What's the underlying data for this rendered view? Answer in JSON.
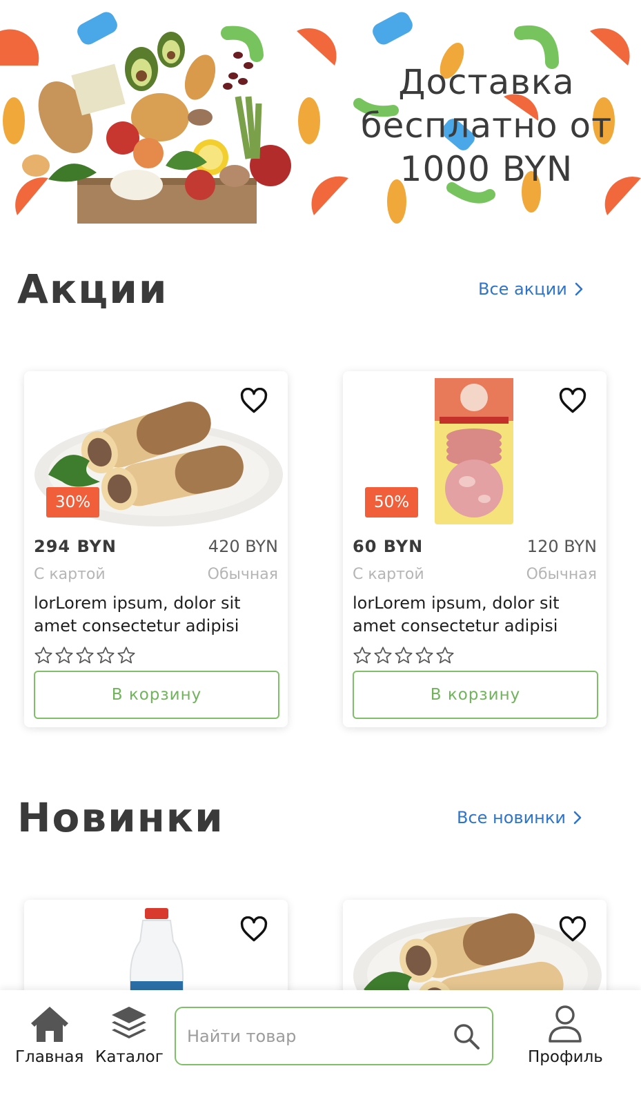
{
  "banner": {
    "title_line1": "Доставка",
    "title_line2": "бесплатно от",
    "title_line3": "1000 BYN"
  },
  "promotions": {
    "title": "Акции",
    "link_label": "Все акции",
    "products": [
      {
        "image": "blini-with-meat-plate",
        "discount": "30%",
        "card_price": "294 BYN",
        "regular_price": "420 BYN",
        "card_price_label": "С картой",
        "regular_price_label": "Обычная",
        "name_line1": "lorLorem ipsum, dolor sit",
        "name_line2": "amet consectetur adipisi",
        "rating": 0,
        "cart_label": "В корзину"
      },
      {
        "image": "sliced-ham-package",
        "discount": "50%",
        "card_price": "60 BYN",
        "regular_price": "120 BYN",
        "card_price_label": "С картой",
        "regular_price_label": "Обычная",
        "name_line1": "lorLorem ipsum, dolor sit",
        "name_line2": "amet consectetur adipisi",
        "rating": 0,
        "cart_label": "В корзину"
      }
    ]
  },
  "new_items": {
    "title": "Новинки",
    "link_label": "Все новинки",
    "products": [
      {
        "image": "milk-bottle"
      },
      {
        "image": "blini-with-meat-plate"
      }
    ]
  },
  "bottom_nav": {
    "home_label": "Главная",
    "catalog_label": "Каталог",
    "search_placeholder": "Найти товар",
    "profile_label": "Профиль"
  },
  "colors": {
    "accent_blue": "#2f74c9",
    "discount_orange": "#f05f3a",
    "button_green": "#7fbf66",
    "text_dark": "#3a3a3a"
  }
}
